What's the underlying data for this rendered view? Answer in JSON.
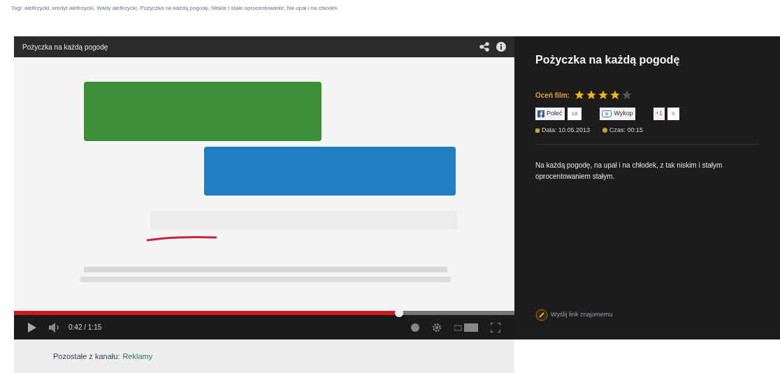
{
  "tags": "Tagi: alefirzycki, kredyt alefirzycki, Wady alefirzycki, Pożyczka na każdą pogodę, Niskie i stałe oprocentowanie, Na upał i na chłodek",
  "player": {
    "title": "Pożyczka na każdą pogodę",
    "progress": {
      "level": 0.77
    },
    "time": "0:42 / 1:15"
  },
  "info": {
    "title": "Pożyczka na każdą pogodę",
    "rating_label": "Oceń film:",
    "stars": 4,
    "social": [
      {
        "kind": "facebook",
        "label": "Poleć",
        "count": "18"
      },
      {
        "kind": "wykop",
        "label": "Wykop"
      },
      {
        "kind": "gplus",
        "label": "+1",
        "count": "0"
      }
    ],
    "date": "Data: 10.05.2013",
    "duration": "Czas: 00:15",
    "description": "Na każdą pogodę, na upał i na chłodek, z tak niskim i stałym oprocentowaniem stałym.",
    "send_link": "Wyślij link znajomemu"
  },
  "channel": {
    "label": "Pozostałe z kanału:",
    "link": "Reklamy"
  }
}
